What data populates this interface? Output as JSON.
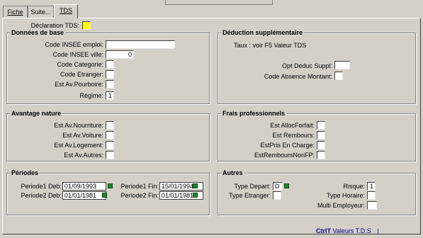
{
  "tabs": [
    "Fiche",
    "Suite...",
    "TDS"
  ],
  "declaration_label": "Déclaration TDS:",
  "donnees": {
    "title": "Données de base",
    "code_insee_emploi": "Code INSEE emploi:",
    "code_insee_ville": "Code INSEE ville:",
    "code_insee_ville_value": "0",
    "code_categorie": "Code Categorie:",
    "code_etranger": "Code Etranger:",
    "est_av_pourboire": "Est Av.Pourboire:",
    "regime": "Régime:",
    "regime_value": "1"
  },
  "deduction": {
    "title": "Déduction supplémentaire",
    "taux": "Taux : voir F5 Valeur TDS",
    "opt_deduc_suppl": "Opt Deduc Suppl:",
    "code_absence_montant": "Code Absence Montant:"
  },
  "avantage": {
    "title": "Avantage nature",
    "nourriture": "Est Av.Nourriture:",
    "voiture": "Est Av.Voiture:",
    "logement": "Est Av.Logement:",
    "autres": "Est Av.Autres:"
  },
  "frais": {
    "title": "Frais professionnels",
    "alloc_forfait": "Est AllocForfait:",
    "rembours": "Est Rembours:",
    "pris_en_charge": "EstPris En Charge:",
    "rembours_non_fp": "EstRemboursNonFP:"
  },
  "periodes": {
    "title": "Périodes",
    "p1_deb_label": "Periode1 Deb:",
    "p1_deb_value": "01/09/1993",
    "p1_fin_label": "Periode1 Fin:",
    "p1_fin_value": "15/01/1994",
    "p2_deb_label": "Periode2 Deb:",
    "p2_deb_value": "01/01/1981",
    "p2_fin_label": "Periode2 Fin:",
    "p2_fin_value": "01/01/1981"
  },
  "autres": {
    "title": "Autres",
    "type_depart": "Type Depart:",
    "type_depart_value": "D",
    "type_etranger": "Type Etranger:",
    "risque": "Risque:",
    "risque_value": "1",
    "type_horaire": "Type Horaire:",
    "multi_employeur": "Multi Employeur:"
  },
  "footer": {
    "shortcut": "CtrlT",
    "label": "Valeurs T.D.S"
  },
  "colors": {
    "accent_checkbox": "#ffff00",
    "date_button": "#1a8a2a",
    "footer_text": "#00008b"
  }
}
